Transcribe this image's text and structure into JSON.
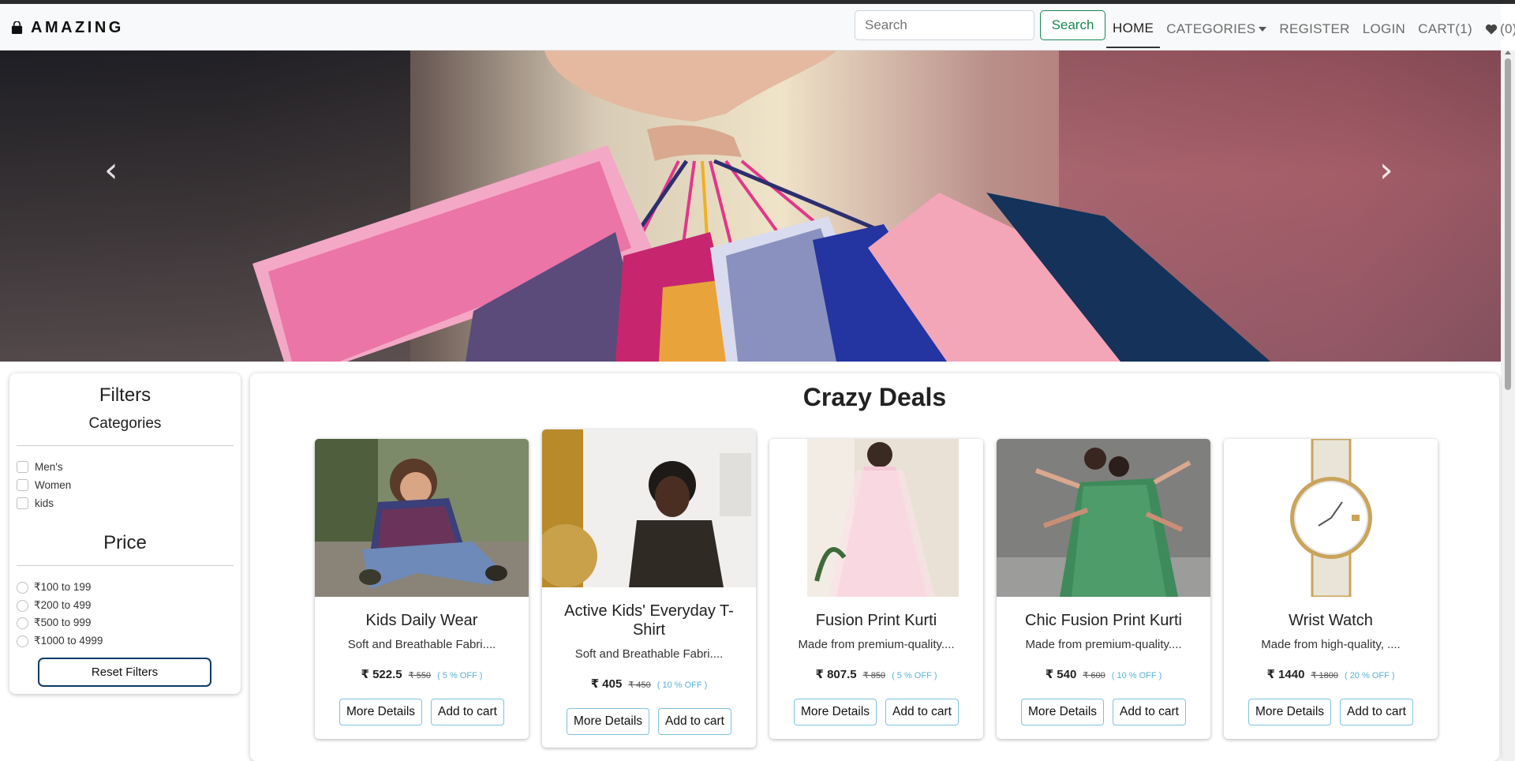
{
  "brand": {
    "name": "AMAZING",
    "icon": "shopping-bag-icon"
  },
  "search": {
    "placeholder": "Search",
    "button_label": "Search"
  },
  "nav": {
    "home": "HOME",
    "categories": "CATEGORIES",
    "register": "REGISTER",
    "login": "LOGIN",
    "cart": "CART(1)",
    "wishlist": "(0)"
  },
  "carousel": {
    "prev_icon": "‹",
    "next_icon": "›"
  },
  "filters": {
    "title": "Filters",
    "categories_title": "Categories",
    "categories": [
      "Men's",
      "Women",
      "kids"
    ],
    "price_title": "Price",
    "prices": [
      "₹100 to 199",
      "₹200 to 499",
      "₹500 to 999",
      "₹1000 to 4999"
    ],
    "reset_label": "Reset Filters"
  },
  "deals": {
    "title": "Crazy Deals",
    "products": [
      {
        "title": "Kids Daily Wear",
        "desc": "Soft and Breathable Fabri....",
        "price": "₹ 522.5",
        "old_price": "₹ 550",
        "off": "( 5 % OFF )"
      },
      {
        "title": "Active Kids' Everyday T-Shirt",
        "desc": "Soft and Breathable Fabri....",
        "price": "₹ 405",
        "old_price": "₹ 450",
        "off": "( 10 % OFF )"
      },
      {
        "title": "Fusion Print Kurti",
        "desc": "Made from premium-quality....",
        "price": "₹ 807.5",
        "old_price": "₹ 850",
        "off": "( 5 % OFF )"
      },
      {
        "title": "Chic Fusion Print Kurti",
        "desc": "Made from premium-quality....",
        "price": "₹ 540",
        "old_price": "₹ 600",
        "off": "( 10 % OFF )"
      },
      {
        "title": "Wrist Watch",
        "desc": "Made from high-quality, ....",
        "price": "₹ 1440",
        "old_price": "₹ 1800",
        "off": "( 20 % OFF )"
      }
    ],
    "more_label": "More Details",
    "cart_label": "Add to cart"
  },
  "colors": {
    "accent_green": "#198754",
    "navy": "#0d3b66",
    "discount_blue": "#5ab0d8"
  }
}
